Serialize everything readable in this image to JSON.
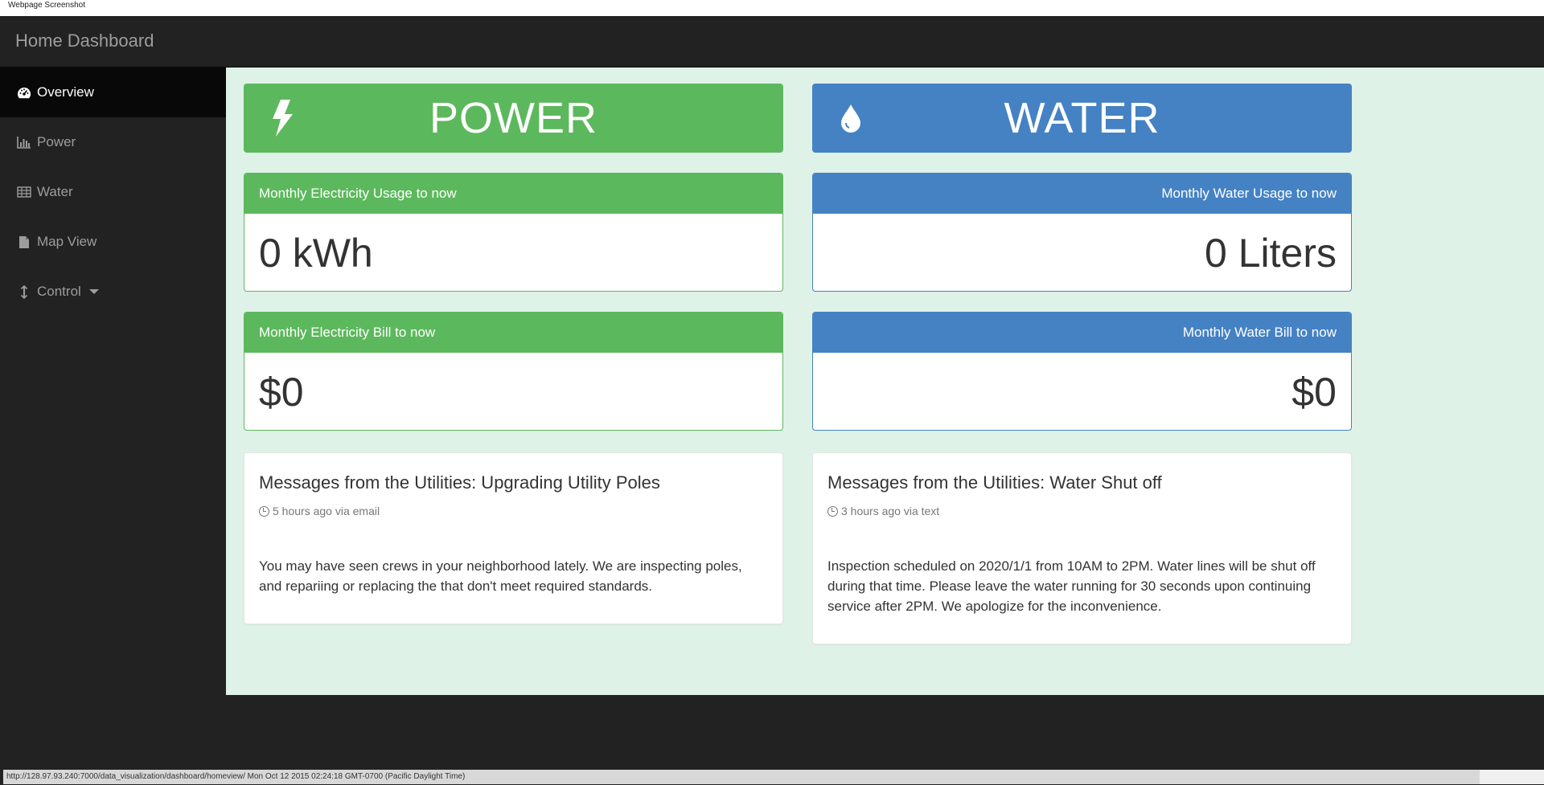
{
  "capture_caption": "Webpage Screenshot",
  "app": {
    "title": "Home Dashboard"
  },
  "sidebar": {
    "items": [
      {
        "label": "Overview",
        "icon": "dashboard-icon",
        "active": true
      },
      {
        "label": "Power",
        "icon": "bar-chart-icon",
        "active": false
      },
      {
        "label": "Water",
        "icon": "table-icon",
        "active": false
      },
      {
        "label": "Map View",
        "icon": "file-icon",
        "active": false
      },
      {
        "label": "Control",
        "icon": "vertical-resize-icon",
        "active": false,
        "has_dropdown": true
      }
    ]
  },
  "power": {
    "banner_title": "POWER",
    "banner_icon": "bolt-icon",
    "usage": {
      "label": "Monthly Electricity Usage to now",
      "value": "0 kWh"
    },
    "bill": {
      "label": "Monthly Electricity Bill to now",
      "value": "$0"
    },
    "message": {
      "title": "Messages from the Utilities: Upgrading Utility Poles",
      "meta": "5 hours ago via email",
      "body": "You may have seen crews in your neighborhood lately. We are inspecting poles, and repariing or replacing the that don't meet required standards."
    }
  },
  "water": {
    "banner_title": "WATER",
    "banner_icon": "droplet-icon",
    "usage": {
      "label": "Monthly Water Usage to now",
      "value": "0 Liters"
    },
    "bill": {
      "label": "Monthly Water Bill to now",
      "value": "$0"
    },
    "message": {
      "title": "Messages from the Utilities: Water Shut off",
      "meta": "3 hours ago via text",
      "body": "Inspection scheduled on 2020/1/1 from 10AM to 2PM. Water lines will be shut off during that time. Please leave the water running for 30 seconds upon continuing service after 2PM. We apologize for the inconvenience."
    }
  },
  "status_bar": {
    "text": "http://128.97.93.240:7000/data_visualization/dashboard/homeview/ Mon Oct 12 2015 02:24:18 GMT-0700 (Pacific Daylight Time)"
  },
  "colors": {
    "power_accent": "#5cb85c",
    "water_accent": "#4582c4",
    "main_background": "#dff2e8",
    "nav_background": "#222222"
  }
}
